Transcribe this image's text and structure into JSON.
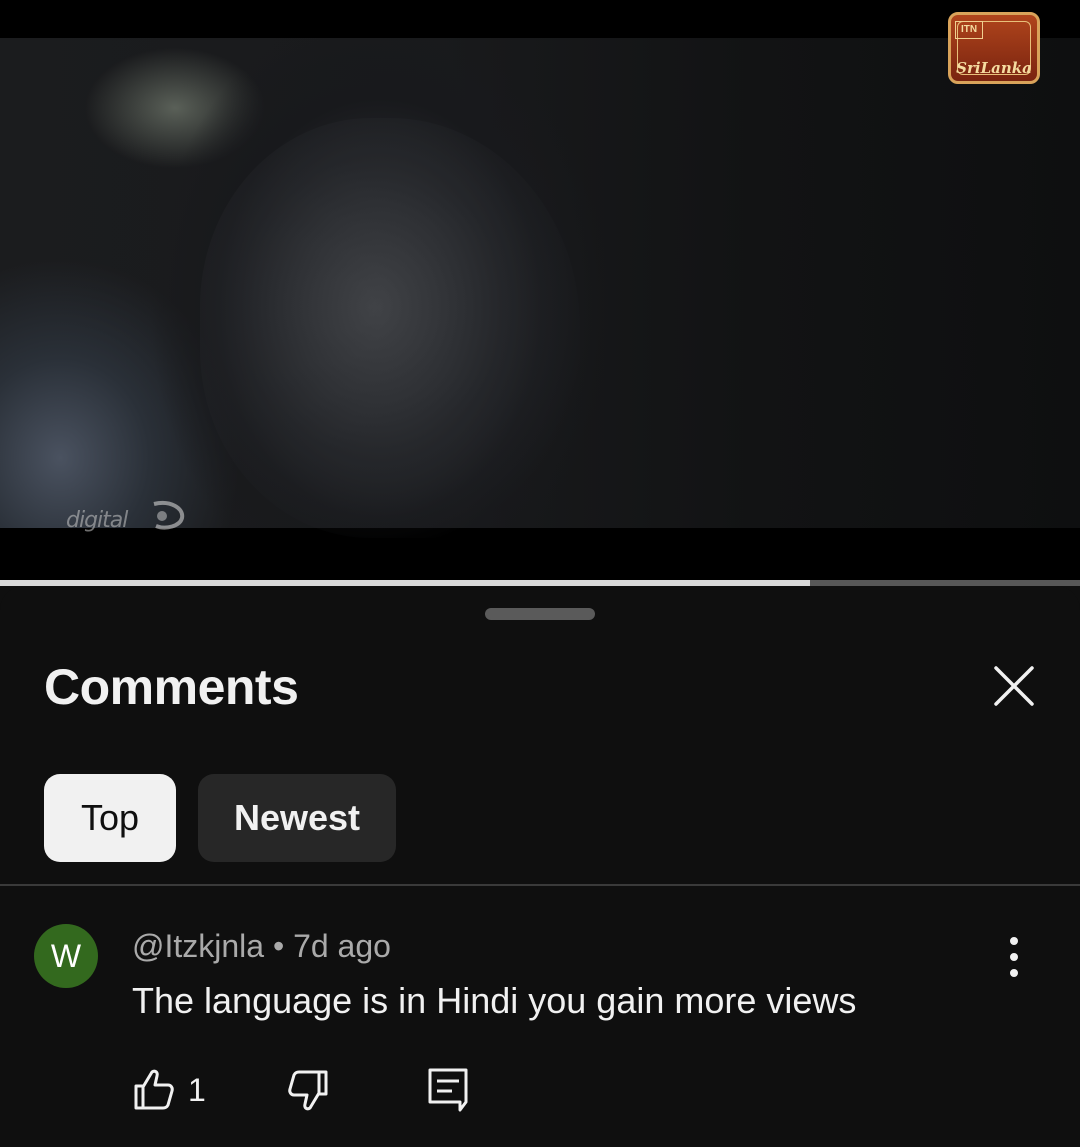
{
  "video": {
    "watermark_text": "digital",
    "channel_logo": {
      "badge_text": "ITN",
      "script_text": "SriLanka"
    },
    "progress_fraction": 0.75
  },
  "comments_sheet": {
    "title": "Comments",
    "close_icon": "close-icon",
    "filters": [
      {
        "label": "Top",
        "selected": true
      },
      {
        "label": "Newest",
        "selected": false
      }
    ]
  },
  "comments": [
    {
      "avatar_letter": "W",
      "avatar_color": "#33691e",
      "author": "@Itzkjnla",
      "separator": "•",
      "time": "7d ago",
      "text": "The language is in Hindi you gain more views",
      "like_count": "1",
      "icons": [
        "thumbs-up-icon",
        "thumbs-down-icon",
        "reply-icon",
        "more-vert-icon"
      ]
    }
  ],
  "colors": {
    "background": "#0f0f0f",
    "chip_selected_bg": "#f1f1f1",
    "chip_unselected_bg": "#272727",
    "text_primary": "#f1f1f1",
    "text_secondary": "#aaaaaa"
  }
}
